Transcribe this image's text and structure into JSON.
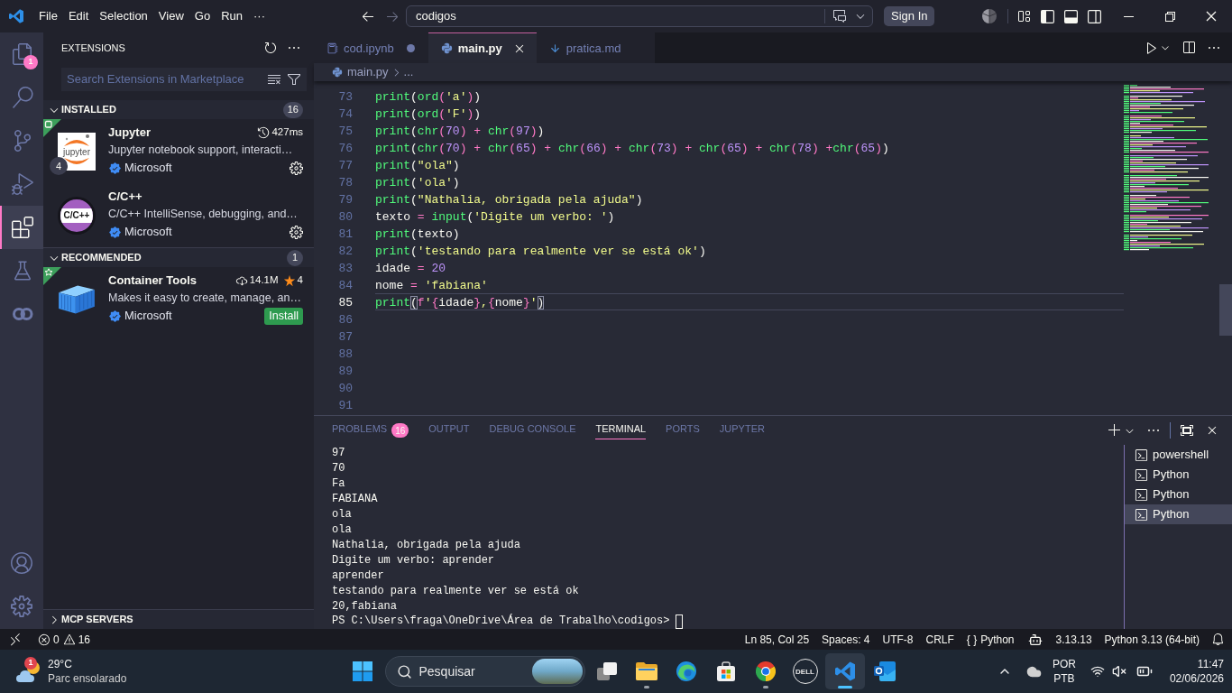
{
  "title_bar": {
    "menus": [
      "File",
      "Edit",
      "Selection",
      "View",
      "Go",
      "Run",
      "···"
    ],
    "command_center": "codigos",
    "sign_in": "Sign In",
    "layout_toggles": [
      {
        "kind": "sidebar-left",
        "on": true
      },
      {
        "kind": "panel",
        "on": true
      },
      {
        "kind": "sidebar-right",
        "on": false
      }
    ]
  },
  "activity_bar": {
    "items": [
      {
        "kind": "files",
        "selected": false,
        "badge": "1"
      },
      {
        "kind": "search",
        "selected": false
      },
      {
        "kind": "source-control",
        "selected": false
      },
      {
        "kind": "run-debug",
        "selected": false
      },
      {
        "kind": "extensions",
        "selected": true
      },
      {
        "kind": "testing",
        "selected": false
      },
      {
        "kind": "rings",
        "selected": false
      }
    ],
    "bottom": [
      {
        "kind": "account"
      },
      {
        "kind": "settings"
      }
    ]
  },
  "sidebar": {
    "title": "EXTENSIONS",
    "search": {
      "placeholder": "Search Extensions in Marketplace"
    },
    "sections": [
      {
        "title": "INSTALLED",
        "expanded": true,
        "count": "16",
        "items": [
          {
            "name": "Jupyter",
            "logo": {
              "kind": "jupyter",
              "text": "jupyter"
            },
            "corner": {
              "kind": "workspace"
            },
            "badge": "4",
            "stats": [
              {
                "kind": "timing",
                "text": "427ms"
              }
            ],
            "description": "Jupyter notebook support, interacti…",
            "publisher": "Microsoft",
            "verified": true,
            "action": {
              "kind": "manage"
            }
          },
          {
            "name": "C/C++",
            "logo": {
              "kind": "cpp",
              "text": "C/C++"
            },
            "description": "C/C++ IntelliSense, debugging, and…",
            "publisher": "Microsoft",
            "verified": true,
            "action": {
              "kind": "manage"
            }
          }
        ]
      },
      {
        "title": "RECOMMENDED",
        "expanded": true,
        "count": "1",
        "items": [
          {
            "name": "Container Tools",
            "logo": {
              "kind": "container"
            },
            "corner": {
              "kind": "recommended"
            },
            "stats": [
              {
                "kind": "downloads",
                "text": "14.1M"
              },
              {
                "kind": "rating",
                "text": "4"
              }
            ],
            "description": "Makes it easy to create, manage, an…",
            "publisher": "Microsoft",
            "verified": true,
            "action": {
              "kind": "install",
              "label": "Install"
            }
          }
        ]
      },
      {
        "title": "MCP SERVERS",
        "expanded": false
      }
    ]
  },
  "editor": {
    "tabs": [
      {
        "label": "cod.ipynb",
        "kind": "notebook",
        "selected": false,
        "modified": true
      },
      {
        "label": "main.py",
        "kind": "python",
        "selected": true,
        "modified": false
      },
      {
        "label": "pratica.md",
        "kind": "markdown",
        "selected": false,
        "modified": false
      }
    ],
    "breadcrumb": [
      "main.py",
      "..."
    ],
    "lines": [
      {
        "number": "73",
        "current": false,
        "tokens": [
          {
            "text": "print",
            "kind": "function"
          },
          {
            "text": "(",
            "kind": "plain"
          },
          {
            "text": "ord",
            "kind": "function"
          },
          {
            "text": "(",
            "kind": "bracket"
          },
          {
            "text": "'a'",
            "kind": "string"
          },
          {
            "text": ")",
            "kind": "bracket"
          },
          {
            "text": ")",
            "kind": "plain"
          }
        ]
      },
      {
        "number": "74",
        "current": false,
        "tokens": [
          {
            "text": "print",
            "kind": "function"
          },
          {
            "text": "(",
            "kind": "plain"
          },
          {
            "text": "ord",
            "kind": "function"
          },
          {
            "text": "(",
            "kind": "bracket"
          },
          {
            "text": "'F'",
            "kind": "string"
          },
          {
            "text": ")",
            "kind": "bracket"
          },
          {
            "text": ")",
            "kind": "plain"
          }
        ]
      },
      {
        "number": "75",
        "current": false,
        "tokens": [
          {
            "text": "print",
            "kind": "function"
          },
          {
            "text": "(",
            "kind": "plain"
          },
          {
            "text": "chr",
            "kind": "function"
          },
          {
            "text": "(",
            "kind": "bracket"
          },
          {
            "text": "70",
            "kind": "number"
          },
          {
            "text": ")",
            "kind": "bracket"
          },
          {
            "text": " + ",
            "kind": "operator"
          },
          {
            "text": "chr",
            "kind": "function"
          },
          {
            "text": "(",
            "kind": "bracket"
          },
          {
            "text": "97",
            "kind": "number"
          },
          {
            "text": ")",
            "kind": "bracket"
          },
          {
            "text": ")",
            "kind": "plain"
          }
        ]
      },
      {
        "number": "76",
        "current": false,
        "tokens": [
          {
            "text": "print",
            "kind": "function"
          },
          {
            "text": "(",
            "kind": "plain"
          },
          {
            "text": "chr",
            "kind": "function"
          },
          {
            "text": "(",
            "kind": "bracket"
          },
          {
            "text": "70",
            "kind": "number"
          },
          {
            "text": ")",
            "kind": "bracket"
          },
          {
            "text": " + ",
            "kind": "operator"
          },
          {
            "text": "chr",
            "kind": "function"
          },
          {
            "text": "(",
            "kind": "bracket"
          },
          {
            "text": "65",
            "kind": "number"
          },
          {
            "text": ")",
            "kind": "bracket"
          },
          {
            "text": " + ",
            "kind": "operator"
          },
          {
            "text": "chr",
            "kind": "function"
          },
          {
            "text": "(",
            "kind": "bracket"
          },
          {
            "text": "66",
            "kind": "number"
          },
          {
            "text": ")",
            "kind": "bracket"
          },
          {
            "text": " + ",
            "kind": "operator"
          },
          {
            "text": "chr",
            "kind": "function"
          },
          {
            "text": "(",
            "kind": "bracket"
          },
          {
            "text": "73",
            "kind": "number"
          },
          {
            "text": ")",
            "kind": "bracket"
          },
          {
            "text": " + ",
            "kind": "operator"
          },
          {
            "text": "chr",
            "kind": "function"
          },
          {
            "text": "(",
            "kind": "bracket"
          },
          {
            "text": "65",
            "kind": "number"
          },
          {
            "text": ")",
            "kind": "bracket"
          },
          {
            "text": " + ",
            "kind": "operator"
          },
          {
            "text": "chr",
            "kind": "function"
          },
          {
            "text": "(",
            "kind": "bracket"
          },
          {
            "text": "78",
            "kind": "number"
          },
          {
            "text": ")",
            "kind": "bracket"
          },
          {
            "text": " +",
            "kind": "operator"
          },
          {
            "text": "chr",
            "kind": "function"
          },
          {
            "text": "(",
            "kind": "bracket"
          },
          {
            "text": "65",
            "kind": "number"
          },
          {
            "text": ")",
            "kind": "bracket"
          },
          {
            "text": ")",
            "kind": "plain"
          }
        ]
      },
      {
        "number": "77",
        "current": false,
        "tokens": [
          {
            "text": "print",
            "kind": "function"
          },
          {
            "text": "(",
            "kind": "plain"
          },
          {
            "text": "\"ola\"",
            "kind": "string"
          },
          {
            "text": ")",
            "kind": "plain"
          }
        ]
      },
      {
        "number": "78",
        "current": false,
        "tokens": [
          {
            "text": "print",
            "kind": "function"
          },
          {
            "text": "(",
            "kind": "plain"
          },
          {
            "text": "'ola'",
            "kind": "string"
          },
          {
            "text": ")",
            "kind": "plain"
          }
        ]
      },
      {
        "number": "79",
        "current": false,
        "tokens": [
          {
            "text": "print",
            "kind": "function"
          },
          {
            "text": "(",
            "kind": "plain"
          },
          {
            "text": "\"Nathalia, obrigada pela ajuda\"",
            "kind": "string"
          },
          {
            "text": ")",
            "kind": "plain"
          }
        ]
      },
      {
        "number": "80",
        "current": false,
        "tokens": [
          {
            "text": "texto",
            "kind": "plain"
          },
          {
            "text": " = ",
            "kind": "operator"
          },
          {
            "text": "input",
            "kind": "function"
          },
          {
            "text": "(",
            "kind": "plain"
          },
          {
            "text": "'Digite um verbo: '",
            "kind": "string"
          },
          {
            "text": ")",
            "kind": "plain"
          }
        ]
      },
      {
        "number": "81",
        "current": false,
        "tokens": [
          {
            "text": "print",
            "kind": "function"
          },
          {
            "text": "(",
            "kind": "plain"
          },
          {
            "text": "texto",
            "kind": "plain"
          },
          {
            "text": ")",
            "kind": "plain"
          }
        ]
      },
      {
        "number": "82",
        "current": false,
        "tokens": [
          {
            "text": "print",
            "kind": "function"
          },
          {
            "text": "(",
            "kind": "plain"
          },
          {
            "text": "'testando para realmente ver se está ok'",
            "kind": "string"
          },
          {
            "text": ")",
            "kind": "plain"
          }
        ]
      },
      {
        "number": "83",
        "current": false,
        "tokens": [
          {
            "text": "idade",
            "kind": "plain"
          },
          {
            "text": " = ",
            "kind": "operator"
          },
          {
            "text": "20",
            "kind": "number"
          }
        ]
      },
      {
        "number": "84",
        "current": false,
        "tokens": [
          {
            "text": "nome",
            "kind": "plain"
          },
          {
            "text": " = ",
            "kind": "operator"
          },
          {
            "text": "'fabiana'",
            "kind": "string"
          }
        ]
      },
      {
        "number": "85",
        "current": true,
        "tokens": [
          {
            "text": "print",
            "kind": "function"
          },
          {
            "text": "(",
            "kind": "match"
          },
          {
            "text": "f",
            "kind": "prefix"
          },
          {
            "text": "'",
            "kind": "string"
          },
          {
            "text": "{",
            "kind": "operator"
          },
          {
            "text": "idade",
            "kind": "plain"
          },
          {
            "text": "}",
            "kind": "operator"
          },
          {
            "text": ",",
            "kind": "string"
          },
          {
            "text": "{",
            "kind": "operator"
          },
          {
            "text": "nome",
            "kind": "plain"
          },
          {
            "text": "}",
            "kind": "operator"
          },
          {
            "text": "'",
            "kind": "string"
          },
          {
            "text": ")",
            "kind": "match"
          }
        ]
      },
      {
        "number": "86",
        "current": false
      },
      {
        "number": "87",
        "current": false
      },
      {
        "number": "88",
        "current": false
      },
      {
        "number": "89",
        "current": false
      },
      {
        "number": "90",
        "current": false
      },
      {
        "number": "91",
        "current": false
      }
    ]
  },
  "panel": {
    "tabs": [
      {
        "label": "PROBLEMS",
        "selected": false,
        "badge": "16"
      },
      {
        "label": "OUTPUT",
        "selected": false
      },
      {
        "label": "DEBUG CONSOLE",
        "selected": false
      },
      {
        "label": "TERMINAL",
        "selected": true
      },
      {
        "label": "PORTS",
        "selected": false
      },
      {
        "label": "JUPYTER",
        "selected": false
      }
    ],
    "terminal_lines": [
      "97",
      "70",
      "Fa",
      "FABIANA",
      "ola",
      "ola",
      "Nathalia, obrigada pela ajuda",
      "Digite um verbo: aprender",
      "aprender",
      "testando para realmente ver se está ok",
      "20,fabiana"
    ],
    "prompt": "PS C:\\Users\\fraga\\OneDrive\\Área de Trabalho\\codigos>",
    "terminals": [
      {
        "label": "powershell",
        "selected": false
      },
      {
        "label": "Python",
        "selected": false
      },
      {
        "label": "Python",
        "selected": false
      },
      {
        "label": "Python",
        "selected": true
      }
    ]
  },
  "status_bar": {
    "errors": "0",
    "warnings": "16",
    "items": [
      "Ln 85, Col 25",
      "Spaces: 4",
      "UTF-8",
      "CRLF"
    ],
    "language_icon": "{ }",
    "language": "Python",
    "version": "3.13.13",
    "interpreter": "Python 3.13 (64-bit)"
  },
  "taskbar": {
    "weather": {
      "badge": "1",
      "temperature": "29°C",
      "condition": "Parc ensolarado"
    },
    "search": {
      "label": "Pesquisar"
    },
    "apps": [
      {
        "kind": "task-view",
        "running": false,
        "selected": false
      },
      {
        "kind": "folder",
        "running": true,
        "selected": false
      },
      {
        "kind": "swirl",
        "running": false,
        "selected": false
      },
      {
        "kind": "store",
        "running": false,
        "selected": false
      },
      {
        "kind": "ring",
        "running": true,
        "selected": false
      },
      {
        "kind": "vendor",
        "logo_text": "DELL",
        "running": false,
        "selected": false
      },
      {
        "kind": "code-editor",
        "running": true,
        "selected": true
      },
      {
        "kind": "mail",
        "running": false,
        "selected": false
      }
    ],
    "input_language": [
      "POR",
      "PTB"
    ],
    "time": "11:47",
    "date": "02/06/2026"
  }
}
